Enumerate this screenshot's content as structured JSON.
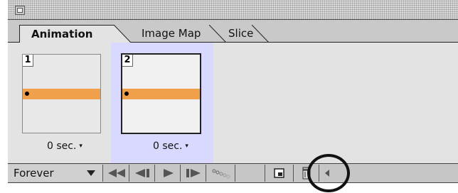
{
  "tabs": [
    {
      "label": "Animation",
      "active": true
    },
    {
      "label": "Image Map",
      "active": false
    },
    {
      "label": "Slice",
      "active": false
    }
  ],
  "frames": [
    {
      "number": "1",
      "delay": "0 sec.",
      "selected": false
    },
    {
      "number": "2",
      "delay": "0 sec.",
      "selected": true
    }
  ],
  "toolbar": {
    "loop_value": "Forever",
    "buttons": [
      "first-frame-icon",
      "previous-frame-icon",
      "play-icon",
      "next-frame-icon",
      "tween-icon",
      "duplicate-frame-icon",
      "delete-frame-icon",
      "scroll-left-icon"
    ]
  },
  "colors": {
    "accent": "#f0a04a",
    "selected_frame": "#d9d9ff",
    "callout": "#111111"
  }
}
